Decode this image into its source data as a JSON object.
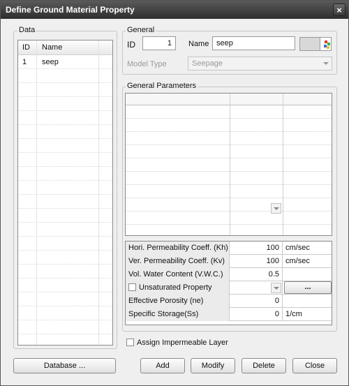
{
  "window": {
    "title": "Define Ground Material Property",
    "close_glyph": "×"
  },
  "data_panel": {
    "title": "Data",
    "columns": [
      "ID",
      "Name"
    ],
    "rows": [
      {
        "id": "1",
        "name": "seep"
      }
    ]
  },
  "general": {
    "title": "General",
    "id_label": "ID",
    "id_value": "1",
    "name_label": "Name",
    "name_value": "seep",
    "model_type_label": "Model Type",
    "model_type_value": "Seepage"
  },
  "params": {
    "title": "General Parameters",
    "rows": [
      {
        "label": "Hori. Permeability Coeff. (Kh)",
        "value": "100",
        "unit": "cm/sec"
      },
      {
        "label": "Ver. Permeability Coeff. (Kv)",
        "value": "100",
        "unit": "cm/sec"
      },
      {
        "label": "Vol. Water Content (V.W.C.)",
        "value": "0.5",
        "unit": ""
      },
      {
        "label": "Unsaturated Property",
        "value": "",
        "unit": "..."
      },
      {
        "label": "Effective Porosity (ne)",
        "value": "0",
        "unit": ""
      },
      {
        "label": "Specific Storage(Ss)",
        "value": "0",
        "unit": "1/cm"
      }
    ]
  },
  "impermeable_label": "Assign Impermeable Layer",
  "buttons": {
    "database": "Database ...",
    "add": "Add",
    "modify": "Modify",
    "delete": "Delete",
    "close": "Close"
  },
  "colors": {
    "title_bar": "#3a3a3a",
    "dialog_bg": "#efefef"
  }
}
